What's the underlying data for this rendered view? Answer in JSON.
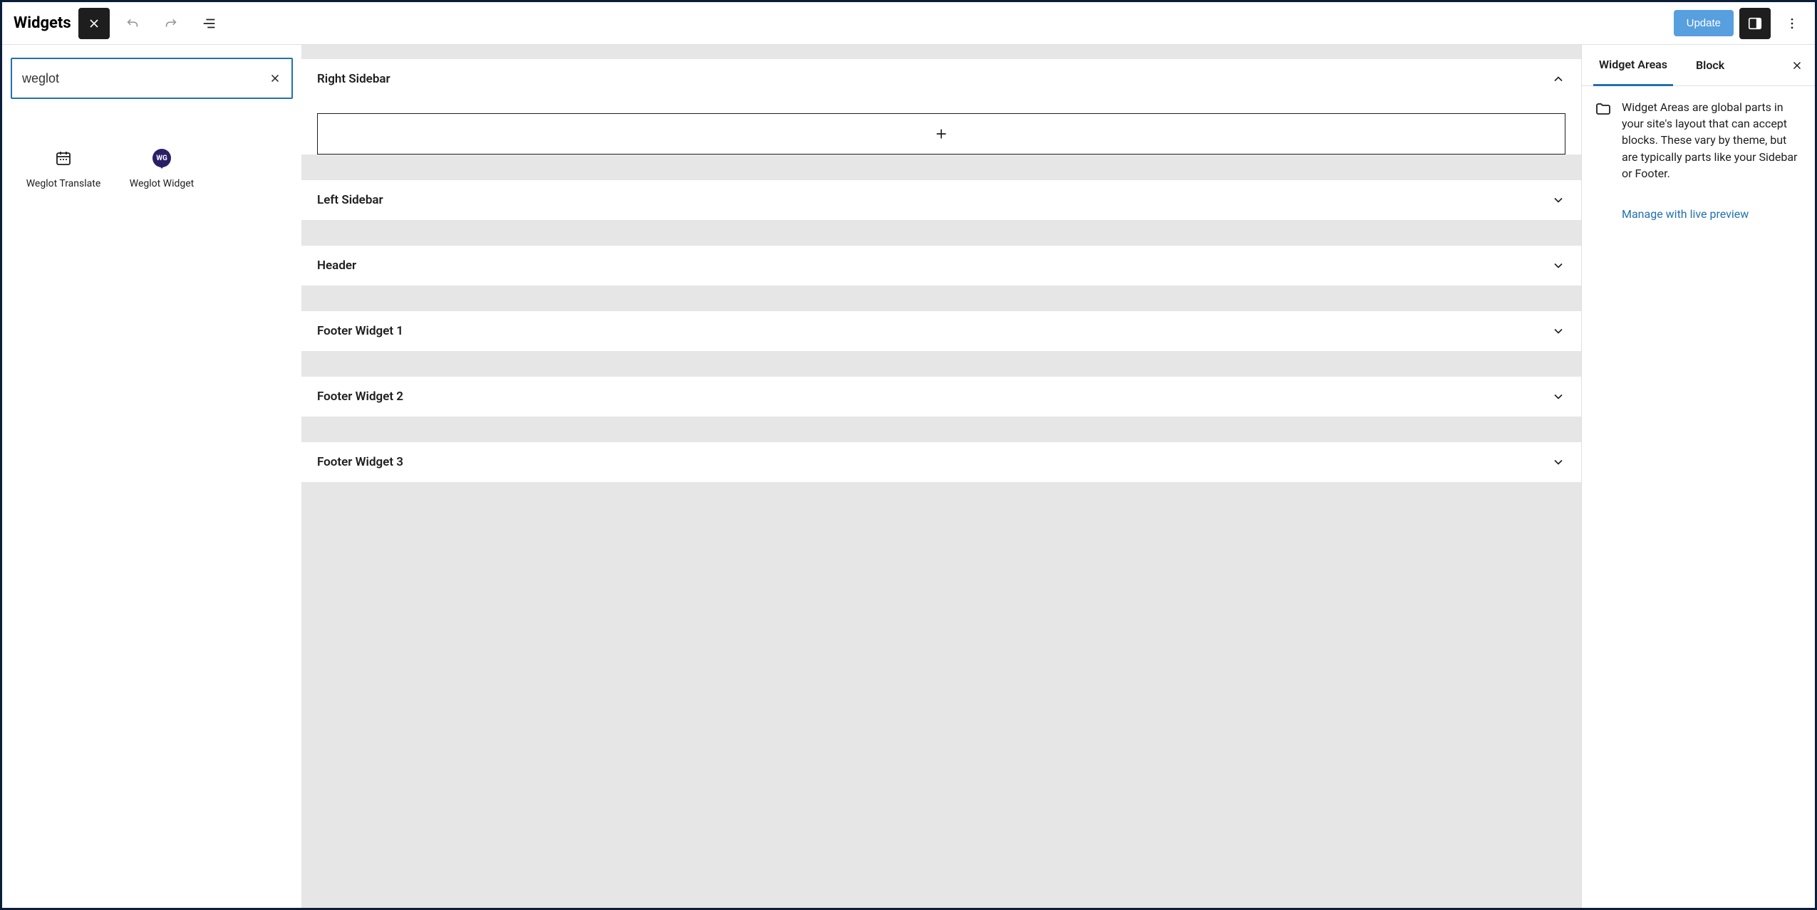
{
  "header": {
    "title": "Widgets",
    "update_label": "Update"
  },
  "search": {
    "value": "weglot"
  },
  "results": [
    {
      "label": "Weglot Translate",
      "icon": "calendar"
    },
    {
      "label": "Weglot Widget",
      "icon": "wg"
    }
  ],
  "areas": [
    {
      "title": "Right Sidebar",
      "open": true
    },
    {
      "title": "Left Sidebar",
      "open": false
    },
    {
      "title": "Header",
      "open": false
    },
    {
      "title": "Footer Widget 1",
      "open": false
    },
    {
      "title": "Footer Widget 2",
      "open": false
    },
    {
      "title": "Footer Widget 3",
      "open": false
    }
  ],
  "sidebar": {
    "tabs": {
      "active": "Widget Areas",
      "inactive": "Block"
    },
    "description": "Widget Areas are global parts in your site's layout that can accept blocks. These vary by theme, but are typically parts like your Sidebar or Footer.",
    "live_preview": "Manage with live preview"
  }
}
